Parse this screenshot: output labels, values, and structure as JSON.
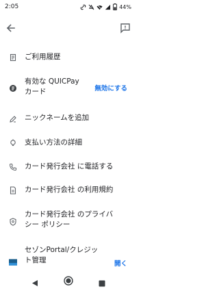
{
  "status_bar": {
    "time": "2:05",
    "battery": "44%"
  },
  "menu": {
    "items": [
      {
        "id": "history",
        "label": "ご利用履歴",
        "icon": "receipt-icon"
      },
      {
        "id": "quicpay",
        "label": "有効な QUICPay\nカード",
        "icon": "quicpay-icon",
        "action": "無効にする"
      },
      {
        "id": "nickname",
        "label": "ニックネームを追加",
        "icon": "edit-icon"
      },
      {
        "id": "payment-details",
        "label": "支払い方法の詳細",
        "icon": "lightbulb-icon"
      },
      {
        "id": "call-issuer",
        "label": "カード発行会社 に電話する",
        "icon": "phone-icon"
      },
      {
        "id": "terms",
        "label": "カード発行会社 の利用規約",
        "icon": "document-icon"
      },
      {
        "id": "privacy",
        "label": "カード発行会社 のプライバ\nシー ポリシー",
        "icon": "shield-icon"
      },
      {
        "id": "saison",
        "label": "セゾンPortal/クレジッ\nト管理",
        "icon": "app-icon",
        "action": "開く"
      }
    ]
  },
  "colors": {
    "accent": "#1a73e8",
    "text": "#202124",
    "icon": "#5f6368"
  }
}
